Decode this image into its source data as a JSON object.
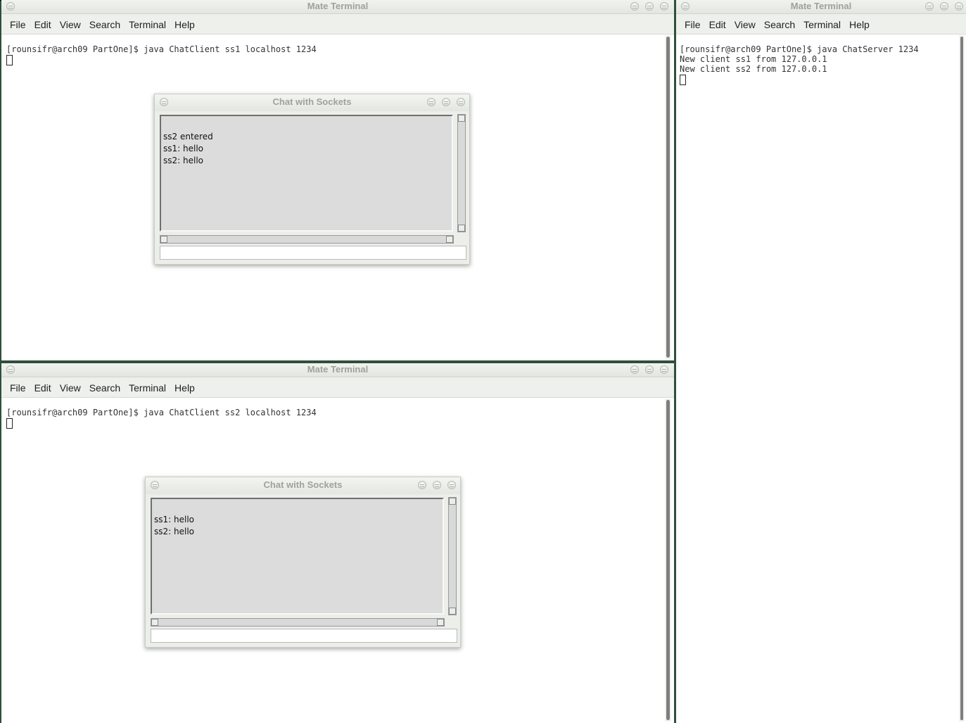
{
  "menu": [
    "File",
    "Edit",
    "View",
    "Search",
    "Terminal",
    "Help"
  ],
  "window_title": "Mate Terminal",
  "chat_title": "Chat with Sockets",
  "term1": {
    "lines": [
      "[rounsifr@arch09 PartOne]$ java ChatClient ss1 localhost 1234"
    ],
    "chat_lines": [
      "",
      "ss2 entered",
      "ss1: hello",
      "ss2: hello"
    ]
  },
  "term2": {
    "lines": [
      "[rounsifr@arch09 PartOne]$ java ChatClient ss2 localhost 1234"
    ],
    "chat_lines": [
      "",
      "ss1: hello",
      "ss2: hello"
    ]
  },
  "term3": {
    "lines": [
      "[rounsifr@arch09 PartOne]$ java ChatServer 1234",
      "New client ss1 from 127.0.0.1",
      "New client ss2 from 127.0.0.1"
    ]
  }
}
